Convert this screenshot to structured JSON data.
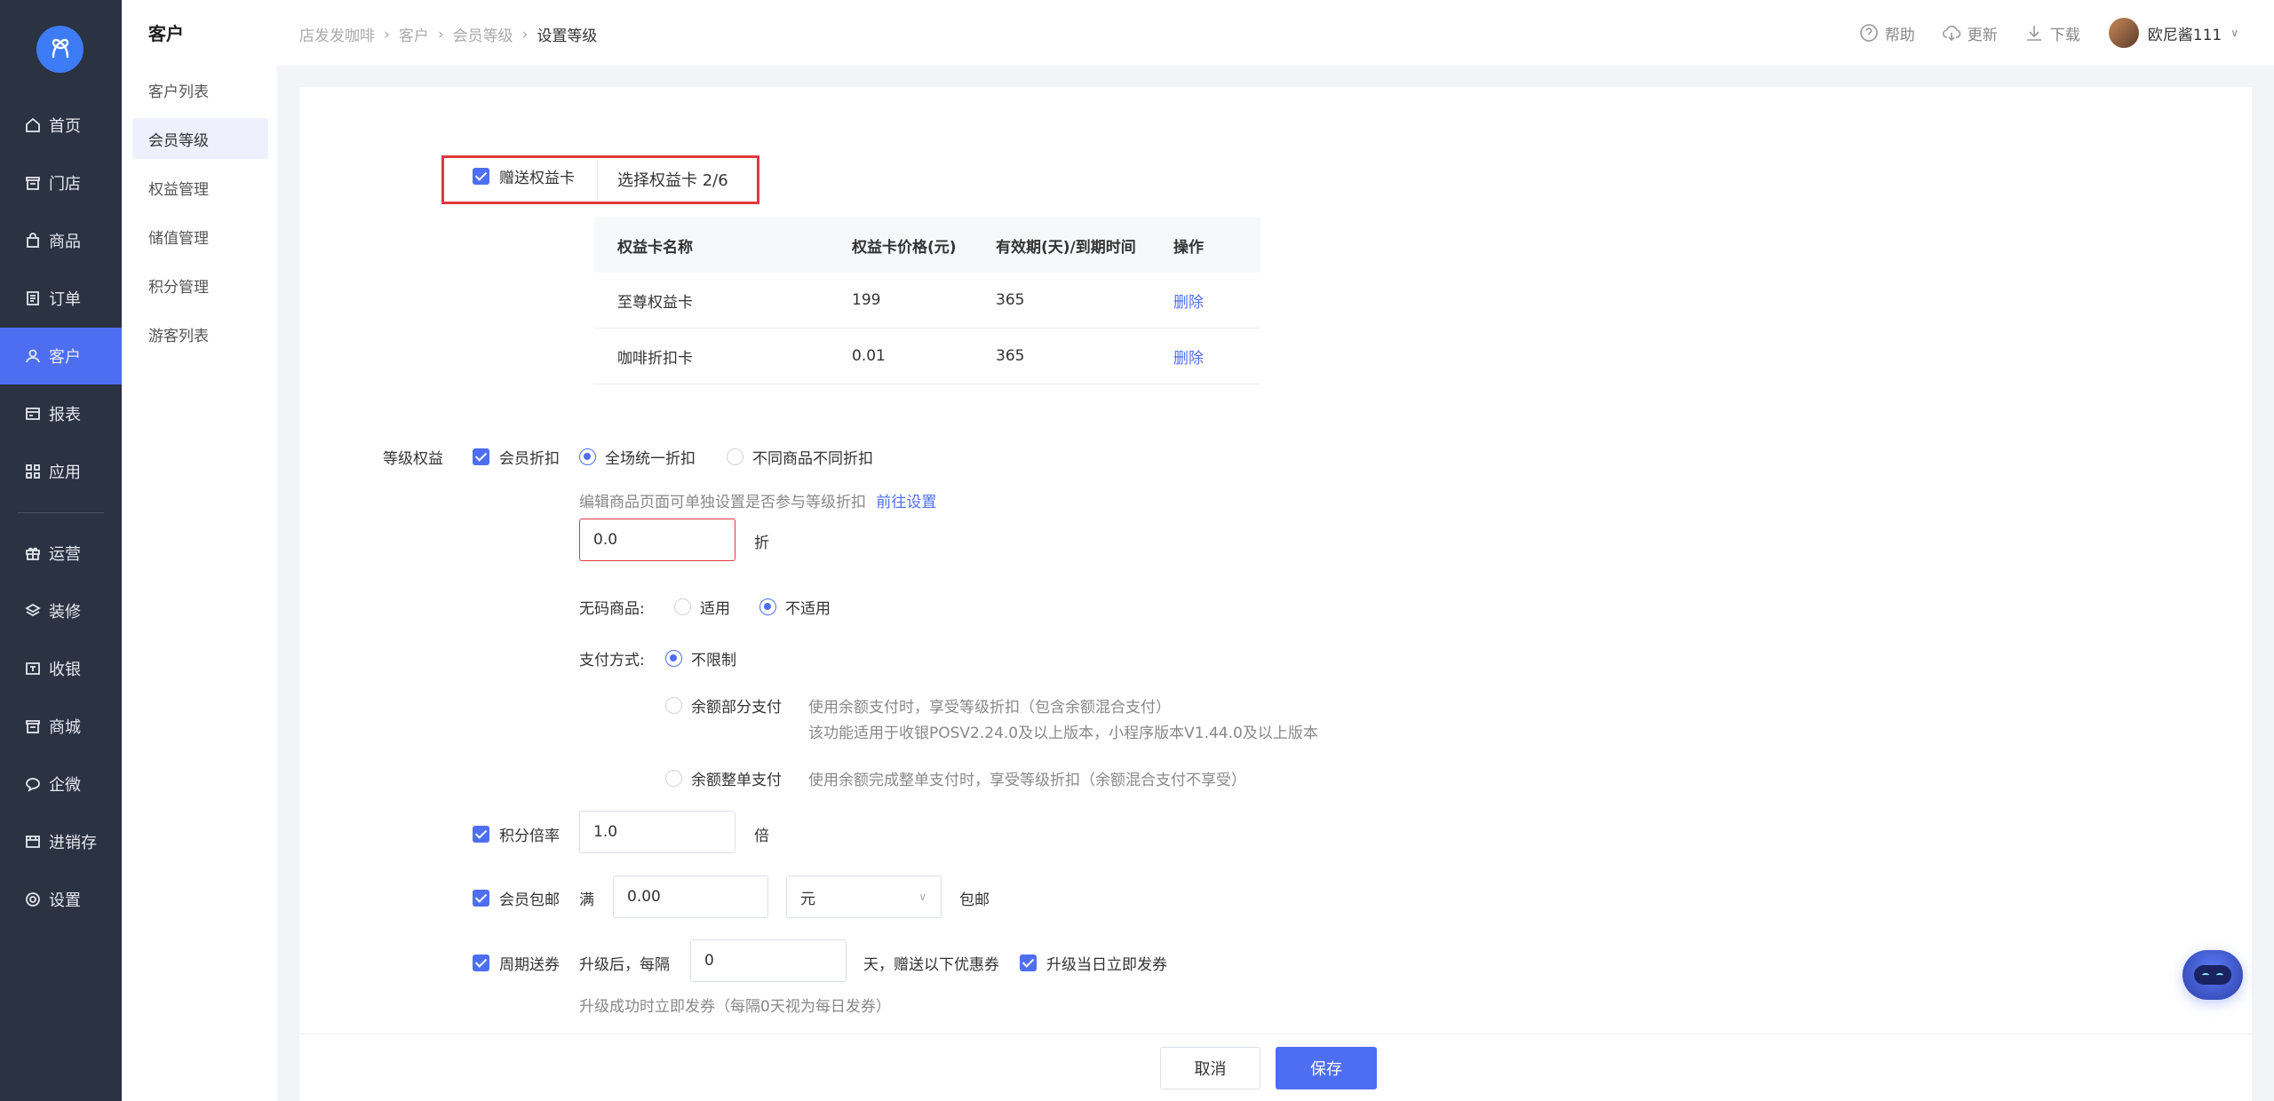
{
  "nav": {
    "items": [
      {
        "label": "首页",
        "icon": "home-icon"
      },
      {
        "label": "门店",
        "icon": "store-icon"
      },
      {
        "label": "商品",
        "icon": "bag-icon"
      },
      {
        "label": "订单",
        "icon": "order-icon"
      },
      {
        "label": "客户",
        "icon": "user-icon"
      },
      {
        "label": "报表",
        "icon": "report-icon"
      },
      {
        "label": "应用",
        "icon": "apps-icon"
      },
      {
        "label": "运营",
        "icon": "gift-icon"
      },
      {
        "label": "装修",
        "icon": "layers-icon"
      },
      {
        "label": "收银",
        "icon": "cashier-icon"
      },
      {
        "label": "商城",
        "icon": "mall-icon"
      },
      {
        "label": "企微",
        "icon": "chat-icon"
      },
      {
        "label": "进销存",
        "icon": "inventory-icon"
      },
      {
        "label": "设置",
        "icon": "settings-icon"
      }
    ]
  },
  "subnav": {
    "title": "客户",
    "items": [
      "客户列表",
      "会员等级",
      "权益管理",
      "储值管理",
      "积分管理",
      "游客列表"
    ]
  },
  "header": {
    "breadcrumb": [
      "店发发咖啡",
      "客户",
      "会员等级",
      "设置等级"
    ],
    "help": "帮助",
    "update": "更新",
    "download": "下载",
    "username": "欧尼酱111"
  },
  "gift": {
    "checkbox_label": "赠送权益卡",
    "select_label": "选择权益卡 2/6"
  },
  "table": {
    "headers": [
      "权益卡名称",
      "权益卡价格(元)",
      "有效期(天)/到期时间",
      "操作"
    ],
    "rows": [
      {
        "name": "至尊权益卡",
        "price": "199",
        "validity": "365",
        "action": "删除"
      },
      {
        "name": "咖啡折扣卡",
        "price": "0.01",
        "validity": "365",
        "action": "删除"
      }
    ]
  },
  "benefits": {
    "label": "等级权益",
    "discount": {
      "checkbox_label": "会员折扣",
      "option_all": "全场统一折扣",
      "option_each": "不同商品不同折扣",
      "hint": "编辑商品页面可单独设置是否参与等级折扣",
      "hint_link": "前往设置",
      "value": "0.0",
      "unit": "折"
    },
    "nocode": {
      "label": "无码商品:",
      "opt_yes": "适用",
      "opt_no": "不适用"
    },
    "payment": {
      "label": "支付方式:",
      "opt_unlimited": "不限制",
      "opt_partial": "余额部分支付",
      "partial_desc1": "使用余额支付时，享受等级折扣（包含余额混合支付）",
      "partial_desc2": "该功能适用于收银POSV2.24.0及以上版本，小程序版本V1.44.0及以上版本",
      "opt_full": "余额整单支付",
      "full_desc": "使用余额完成整单支付时，享受等级折扣（余额混合支付不享受）"
    },
    "points": {
      "checkbox_label": "积分倍率",
      "value": "1.0",
      "unit": "倍"
    },
    "shipping": {
      "checkbox_label": "会员包邮",
      "prefix": "满",
      "value": "0.00",
      "currency": "元",
      "suffix": "包邮"
    },
    "coupon": {
      "checkbox_label": "周期送券",
      "prefix": "升级后，每隔",
      "value": "0",
      "suffix": "天，赠送以下优惠券",
      "immediate_label": "升级当日立即发券",
      "hint": "升级成功时立即发券（每隔0天视为每日发券）"
    }
  },
  "footer": {
    "cancel": "取消",
    "save": "保存"
  },
  "colors": {
    "primary": "#4e6ef2",
    "nav_bg": "#2b3242",
    "highlight": "#e0393e"
  }
}
